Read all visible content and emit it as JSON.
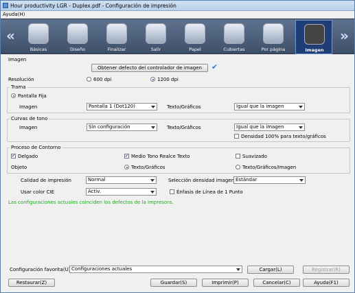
{
  "window": {
    "title": "Hour productivity LGR - Duplex.pdf - Configuración de impresión"
  },
  "menu": {
    "help": "Ayuda(H)"
  },
  "toolbar": {
    "left_arrow": "«",
    "right_arrow": "»",
    "tabs": [
      {
        "label": "Básicas"
      },
      {
        "label": "Diseño"
      },
      {
        "label": "Finalizar"
      },
      {
        "label": "Salir"
      },
      {
        "label": "Papel"
      },
      {
        "label": "Cubiertas"
      },
      {
        "label": "Por página"
      },
      {
        "label": "Imagen"
      }
    ]
  },
  "imagen": {
    "title": "Imagen",
    "default_button": "Obtener defecto del controlador de imagen",
    "resolution_label": "Resolución",
    "res_600": "600 dpi",
    "res_1200": "1200 dpi"
  },
  "trama": {
    "title": "Trama",
    "fixed": "Pantalla Fija",
    "image_label": "Imagen",
    "image_value": "Pantalla 1 (Dot120)",
    "text_label": "Texto/Gráficos",
    "text_value": "Igual que la imagen"
  },
  "curvas": {
    "title": "Curvas de tono",
    "image_label": "Imagen",
    "image_value": "Sin configuración",
    "text_label": "Texto/Gráficos",
    "text_value": "Igual que la imagen",
    "density_label": "Densidad 100% para texto/gráficos"
  },
  "contorno": {
    "title": "Proceso de Contorno",
    "thin": "Delgado",
    "halftone": "Medio Tono Realce Texto",
    "smooth": "Suavizado",
    "object_label": "Objeto",
    "obj_text": "Texto/Gráficos",
    "obj_text_img": "Texto/Gráficos/Imagen"
  },
  "quality": {
    "label": "Calidad de impresión",
    "value": "Normal",
    "density_label": "Selección densidad imagen",
    "density_value": "Estándar",
    "cie_label": "Usar color CIE",
    "cie_value": "Activ.",
    "emphasis_label": "Énfasis de Línea de 1 Punto"
  },
  "status": {
    "message": "Las configuraciones actuales coinciden los defectos de la impresora."
  },
  "bottom": {
    "fav_label": "Configuración favorita(U)",
    "fav_value": "Configuraciones actuales",
    "load": "Cargar(L)",
    "register": "Registrar(R)",
    "restore": "Restaurar(Z)",
    "save": "Guardar(S)",
    "print": "Imprimir(P)",
    "cancel": "Cancelar(C)",
    "help": "Ayuda(F1)"
  },
  "colors": {
    "accent": "#1f3e78",
    "ok_text": "#22aa22",
    "check": "#2a7fd4"
  }
}
